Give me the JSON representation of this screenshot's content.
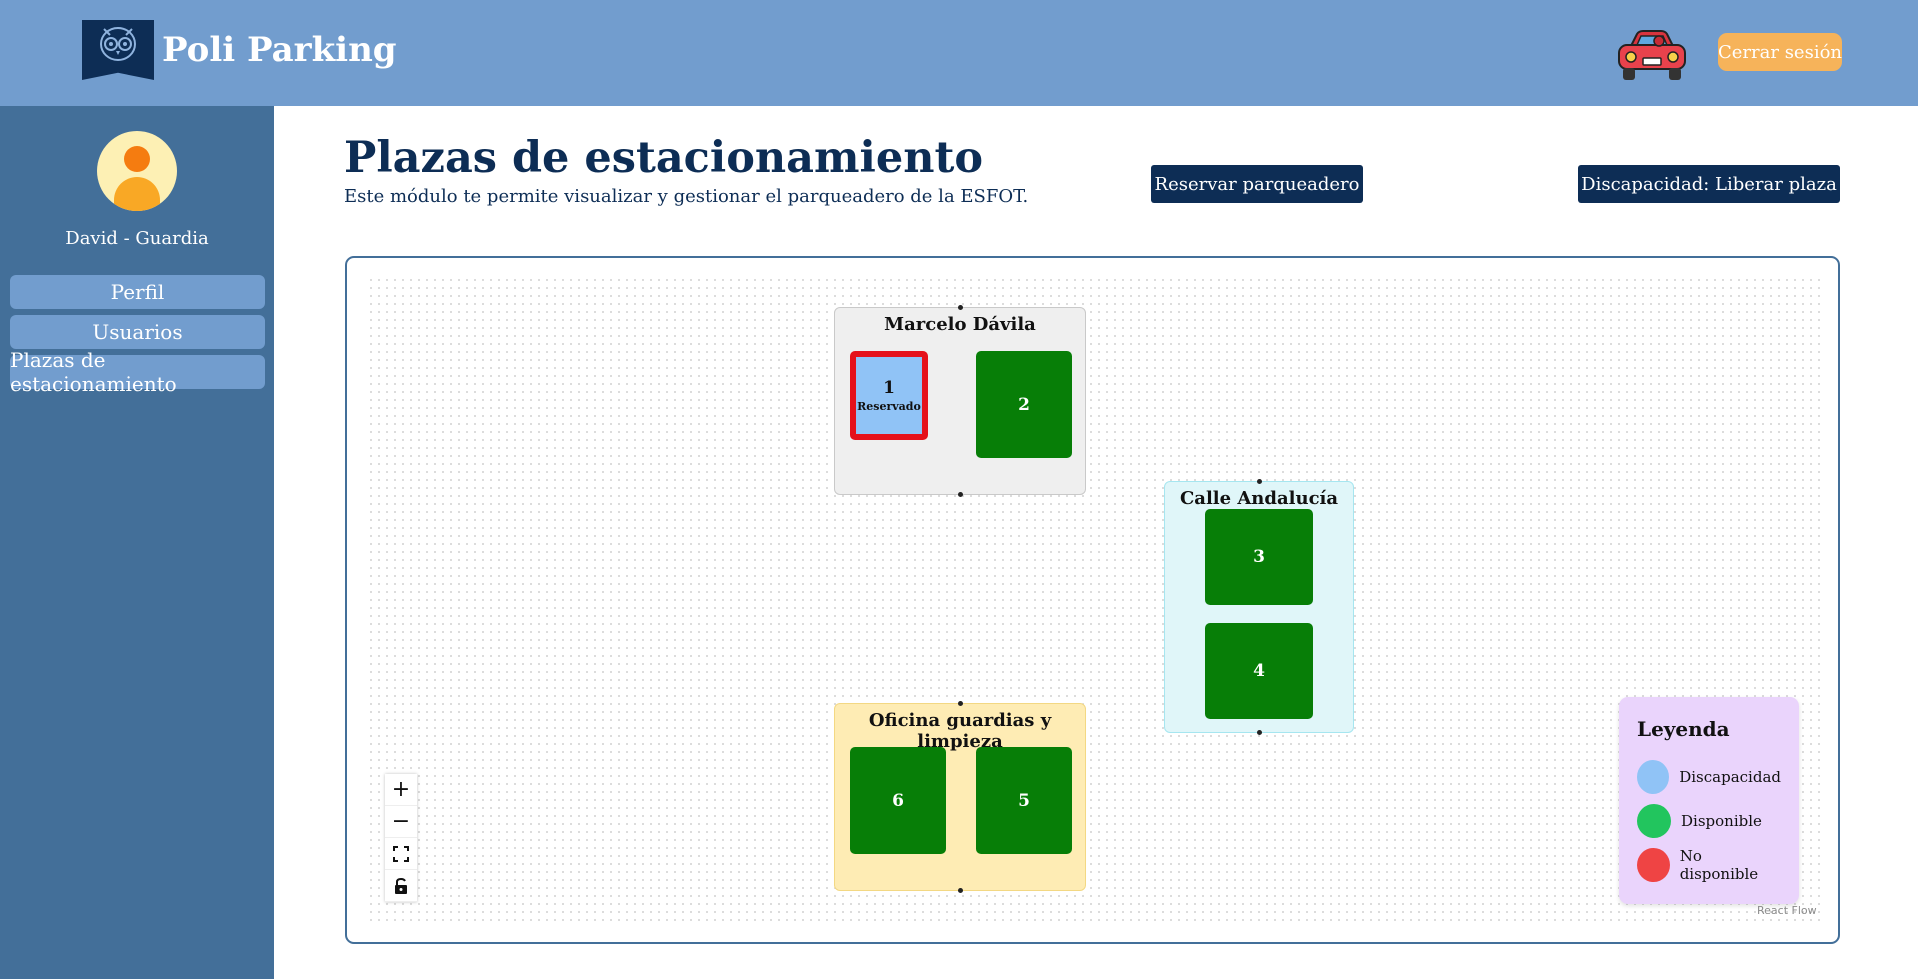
{
  "header": {
    "app_name": "Poli Parking",
    "logout_label": "Cerrar sesión",
    "logo_icon": "owl-logo-icon",
    "car_icon": "car-icon"
  },
  "sidebar": {
    "user_name": "David - Guardia",
    "items": [
      {
        "label": "Perfil"
      },
      {
        "label": "Usuarios"
      },
      {
        "label": "Plazas de estacionamiento"
      }
    ]
  },
  "main": {
    "title": "Plazas de estacionamiento",
    "description": "Este módulo te permite visualizar y gestionar el parqueadero de la ESFOT.",
    "reserve_button": "Reservar parqueadero",
    "release_button": "Discapacidad: Liberar plaza"
  },
  "flow": {
    "groups": [
      {
        "title": "Marcelo Dávila"
      },
      {
        "title": "Calle Andalucía"
      },
      {
        "title": "Oficina guardias y limpieza"
      }
    ],
    "spots": [
      {
        "number": "1",
        "status_text": "Reservado",
        "type": "discapacidad",
        "available": false
      },
      {
        "number": "2",
        "type": "regular",
        "available": true
      },
      {
        "number": "3",
        "type": "regular",
        "available": true
      },
      {
        "number": "4",
        "type": "regular",
        "available": true
      },
      {
        "number": "6",
        "type": "regular",
        "available": true
      },
      {
        "number": "5",
        "type": "regular",
        "available": true
      }
    ],
    "controls": {
      "zoom_in": "+",
      "zoom_out": "−"
    },
    "attribution": "React Flow"
  },
  "legend": {
    "title": "Leyenda",
    "items": [
      {
        "label": "Discapacidad",
        "color": "#90c3f6"
      },
      {
        "label": "Disponible",
        "color": "#22c55e"
      },
      {
        "label": "No disponible",
        "color": "#ef4444"
      }
    ]
  }
}
